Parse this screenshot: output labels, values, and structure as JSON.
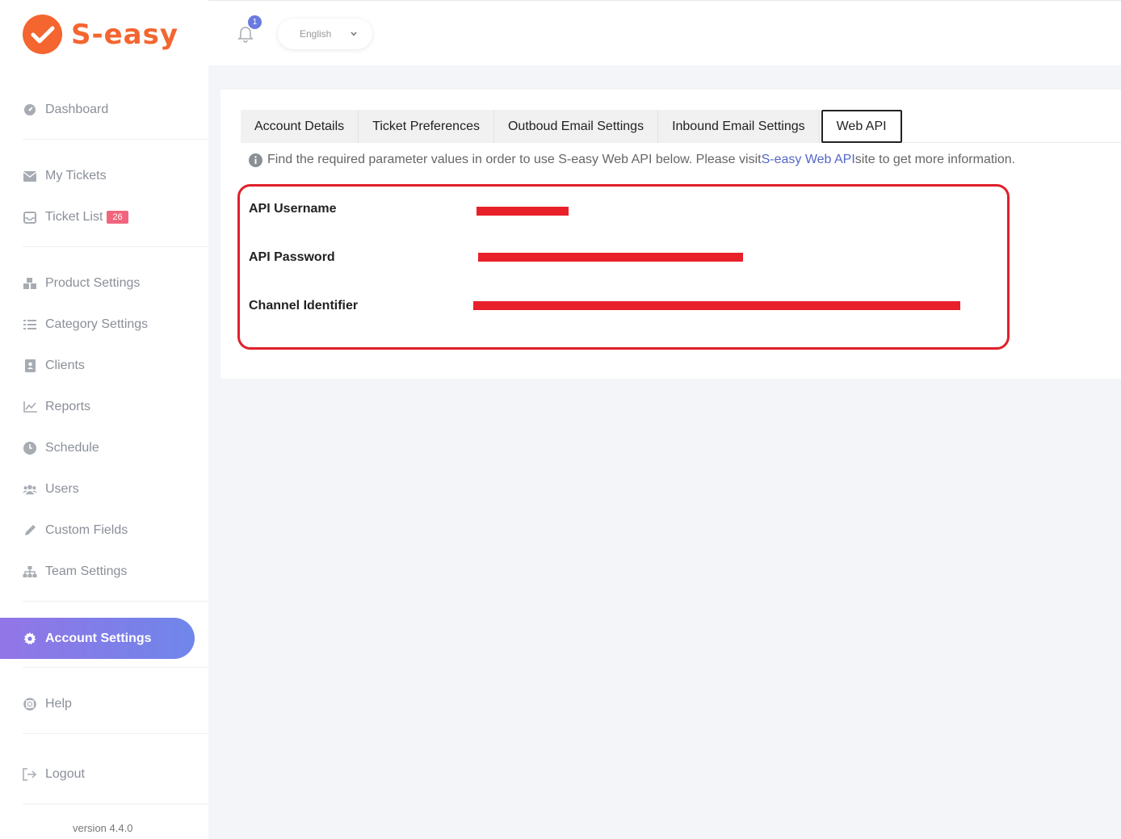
{
  "brand": {
    "name": "S-easy",
    "color": "#f4652f"
  },
  "sidebar": {
    "items": [
      {
        "label": "Dashboard",
        "icon": "dashboard-icon"
      },
      {
        "label": "My Tickets",
        "icon": "envelope-icon"
      },
      {
        "label": "Ticket List",
        "icon": "inbox-icon",
        "badge": "26"
      },
      {
        "label": "Product Settings",
        "icon": "cubes-icon"
      },
      {
        "label": "Category Settings",
        "icon": "list-icon"
      },
      {
        "label": "Clients",
        "icon": "address-book-icon"
      },
      {
        "label": "Reports",
        "icon": "line-chart-icon"
      },
      {
        "label": "Schedule",
        "icon": "clock-icon"
      },
      {
        "label": "Users",
        "icon": "users-icon"
      },
      {
        "label": "Custom Fields",
        "icon": "pencil-icon"
      },
      {
        "label": "Team Settings",
        "icon": "sitemap-icon"
      },
      {
        "label": "Account Settings",
        "icon": "gear-icon",
        "active": true
      },
      {
        "label": "Help",
        "icon": "life-ring-icon"
      },
      {
        "label": "Logout",
        "icon": "sign-out-icon"
      }
    ],
    "version": "version 4.4.0",
    "active_gradient": [
      "#9275e6",
      "#6f86ea"
    ]
  },
  "header": {
    "notification_count": "1",
    "language": "English"
  },
  "tabs": [
    {
      "label": "Account Details"
    },
    {
      "label": "Ticket Preferences"
    },
    {
      "label": "Outboud Email Settings"
    },
    {
      "label": "Inbound Email Settings"
    },
    {
      "label": "Web API",
      "active": true
    }
  ],
  "info": {
    "text_before": "Find the required parameter values in order to use S-easy Web API below. Please visit ",
    "link": "S-easy Web API",
    "text_after": "site to get more information."
  },
  "api_fields": [
    {
      "label": "API Username",
      "value": "[redacted]"
    },
    {
      "label": "API Password",
      "value": "[redacted]"
    },
    {
      "label": "Channel Identifier",
      "value": "[redacted]"
    }
  ],
  "colors": {
    "highlight_box": "#e0202a",
    "redaction": "#e8202a",
    "badge": "#f0657d",
    "link": "#5566c8"
  }
}
